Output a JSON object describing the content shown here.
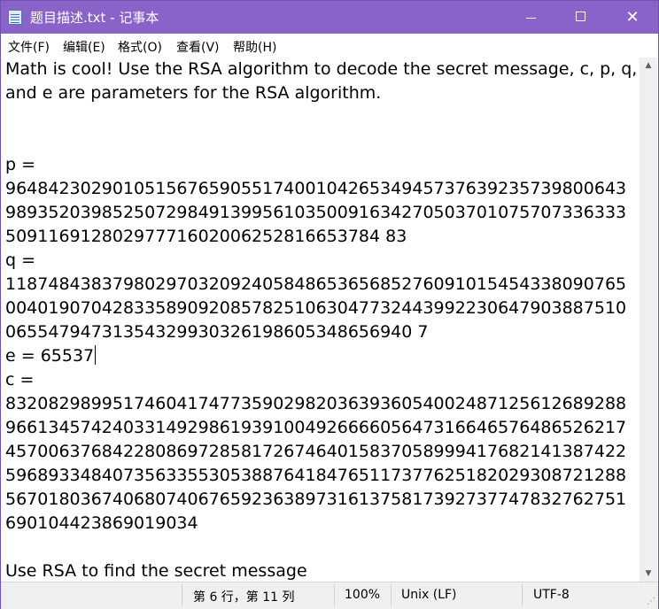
{
  "window": {
    "title": "题目描述.txt - 记事本"
  },
  "controls": {
    "minimize": "—",
    "maximize": "□",
    "close": "✕"
  },
  "menu": {
    "file": "文件(F)",
    "edit": "编辑(E)",
    "format": "格式(O)",
    "view": "查看(V)",
    "help": "帮助(H)"
  },
  "editor": {
    "lines": [
      "Math is cool! Use the RSA algorithm to decode the secret message, c, p, q,",
      "and e are parameters for the RSA algorithm.",
      "",
      "",
      "p =",
      "9648423029010515676590551740010426534945737639235739800643",
      "9893520398525072984913995610350091634270503701075707336333",
      "50911691280297771602006252816653784 83",
      "q =",
      "1187484383798029703209240584865365685276091015454338090765",
      "0040190704283358909208578251063047732443992230647903887510",
      "06554794731354329930326198605348656940 7",
      "e =  65537",
      "c =",
      "8320829899517460417477359029820363936054002487125612689288",
      "9661345742403314929861939100492666605647316646576486526217",
      "4570063768422808697285817267464015837058999417682141387422",
      "5968933484073563355305388764184765117377625182029308721288",
      "5670180367406807406765923638973161375817392737747832762751",
      "690104423869019034",
      "",
      "Use RSA to find the secret message"
    ]
  },
  "status": {
    "position": "第 6 行，第 11 列",
    "zoom": "100%",
    "line_ending": "Unix (LF)",
    "encoding": "UTF-8"
  }
}
